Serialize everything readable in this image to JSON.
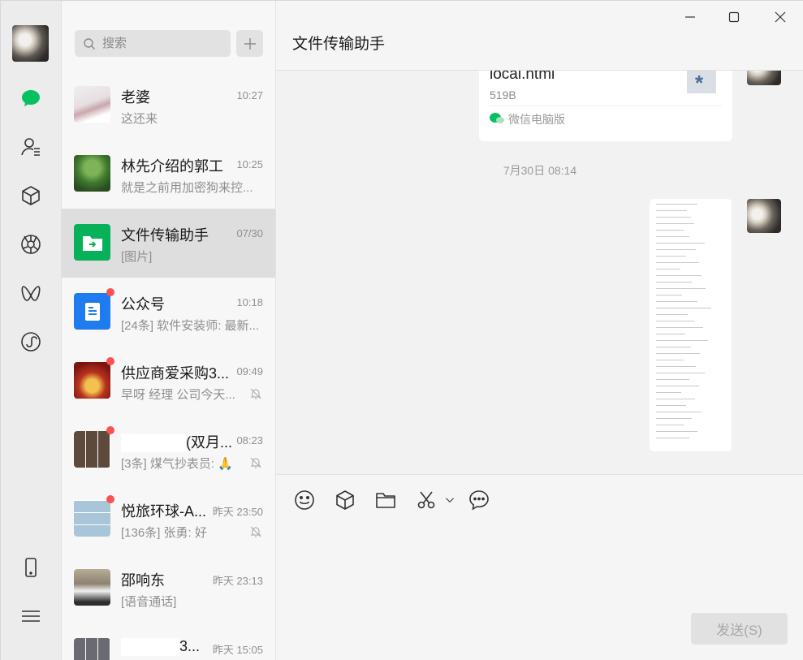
{
  "nav": {
    "items": [
      "chats-icon",
      "contacts-icon",
      "favorites-icon",
      "moments-icon",
      "channels-icon",
      "mini-programs-icon"
    ],
    "active_color": "#07c160"
  },
  "search": {
    "placeholder": "搜索"
  },
  "chats": [
    {
      "name": "老婆",
      "time": "10:27",
      "preview": "这还来",
      "unread": false,
      "muted": false,
      "active": false
    },
    {
      "name": "林先介绍的郭工",
      "time": "10:25",
      "preview": "就是之前用加密狗来控...",
      "unread": false,
      "muted": false,
      "active": false
    },
    {
      "name": "文件传输助手",
      "time": "07/30",
      "preview": "[图片]",
      "unread": false,
      "muted": false,
      "active": true
    },
    {
      "name": "公众号",
      "time": "10:18",
      "preview": "[24条] 软件安装师: 最新...",
      "unread": true,
      "muted": false,
      "active": false
    },
    {
      "name": "供应商爱采购3...",
      "time": "09:49",
      "preview": "早呀 经理 公司今天...",
      "unread": true,
      "muted": true,
      "active": false
    },
    {
      "name": "(双月...",
      "time": "08:23",
      "preview": "[3条] 煤气抄表员: 🙏",
      "unread": true,
      "muted": true,
      "active": false
    },
    {
      "name": "悦旅环球-A...",
      "time": "昨天 23:50",
      "preview": "[136条] 张勇: 好",
      "unread": true,
      "muted": true,
      "active": false
    },
    {
      "name": "邵响东",
      "time": "昨天 23:13",
      "preview": "[语音通话]",
      "unread": false,
      "muted": false,
      "active": false
    },
    {
      "name": "3...",
      "time": "昨天 15:05",
      "preview": "",
      "unread": false,
      "muted": false,
      "active": false
    }
  ],
  "main": {
    "title": "文件传输助手",
    "file": {
      "name": "local.html",
      "size": "519B",
      "source": "微信电脑版"
    },
    "timestamp": "7月30日 08:14",
    "send_label": "发送(S)"
  }
}
